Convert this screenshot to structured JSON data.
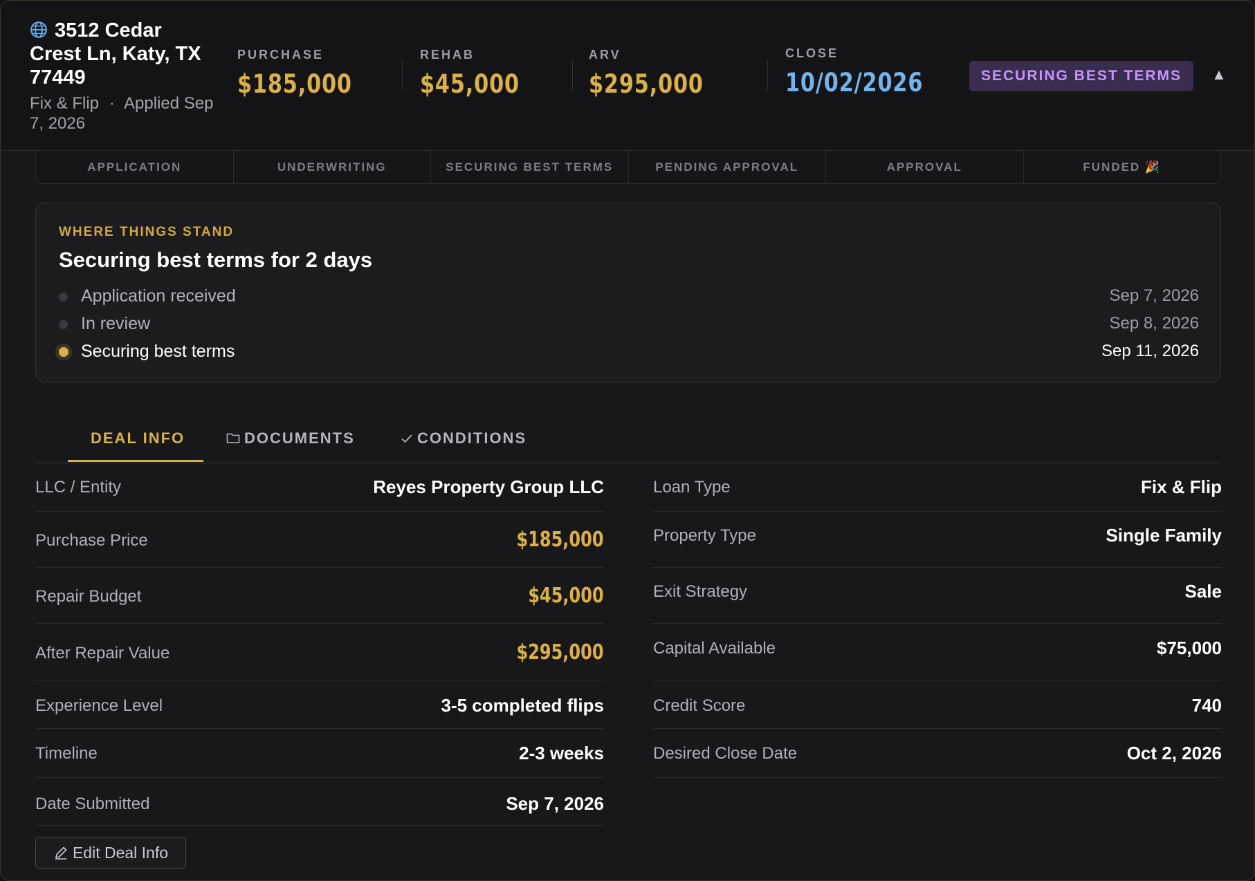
{
  "header": {
    "address_line": "3512 Cedar Crest Ln, Katy, TX 77449",
    "loan_type": "Fix & Flip",
    "separator": "·",
    "applied": "Applied Sep 7, 2026",
    "stats": [
      {
        "label": "PURCHASE",
        "value": "$185,000"
      },
      {
        "label": "REHAB",
        "value": "$45,000"
      },
      {
        "label": "ARV",
        "value": "$295,000"
      },
      {
        "label": "CLOSE",
        "value": "10/02/2026"
      }
    ],
    "status": "SECURING BEST TERMS",
    "collapse_glyph": "▲"
  },
  "stepper": [
    "APPLICATION",
    "UNDERWRITING",
    "SECURING BEST TERMS",
    "PENDING APPROVAL",
    "APPROVAL",
    "FUNDED 🎉"
  ],
  "stand": {
    "kicker": "WHERE THINGS STAND",
    "title": "Securing best terms for 2 days",
    "timeline": [
      {
        "label": "Application received",
        "date": "Sep 7, 2026"
      },
      {
        "label": "In review",
        "date": "Sep 8, 2026"
      },
      {
        "label": "Securing best terms",
        "date": "Sep 11, 2026"
      }
    ]
  },
  "tabs": [
    "DEAL INFO",
    "DOCUMENTS",
    "CONDITIONS"
  ],
  "fields_left": [
    {
      "label": "LLC / Entity",
      "value": "Reyes Property Group LLC"
    },
    {
      "label": "Purchase Price",
      "value": "$185,000"
    },
    {
      "label": "Repair Budget",
      "value": "$45,000"
    },
    {
      "label": "After Repair Value",
      "value": "$295,000"
    },
    {
      "label": "Experience Level",
      "value": "3-5 completed flips"
    },
    {
      "label": "Timeline",
      "value": "2-3 weeks"
    },
    {
      "label": "Date Submitted",
      "value": "Sep 7, 2026"
    }
  ],
  "fields_right": [
    {
      "label": "Loan Type",
      "value": "Fix & Flip"
    },
    {
      "label": "Property Type",
      "value": "Single Family"
    },
    {
      "label": "Exit Strategy",
      "value": "Sale"
    },
    {
      "label": "Capital Available",
      "value": "$75,000"
    },
    {
      "label": "Credit Score",
      "value": "740"
    },
    {
      "label": "Desired Close Date",
      "value": "Oct 2, 2026"
    }
  ],
  "edit_button": "Edit Deal Info",
  "colors": {
    "accent_gold": "#d9b04a",
    "accent_blue": "#73b4ec",
    "status_purple": "#c593ff",
    "status_bg": "#3a2d4f"
  }
}
